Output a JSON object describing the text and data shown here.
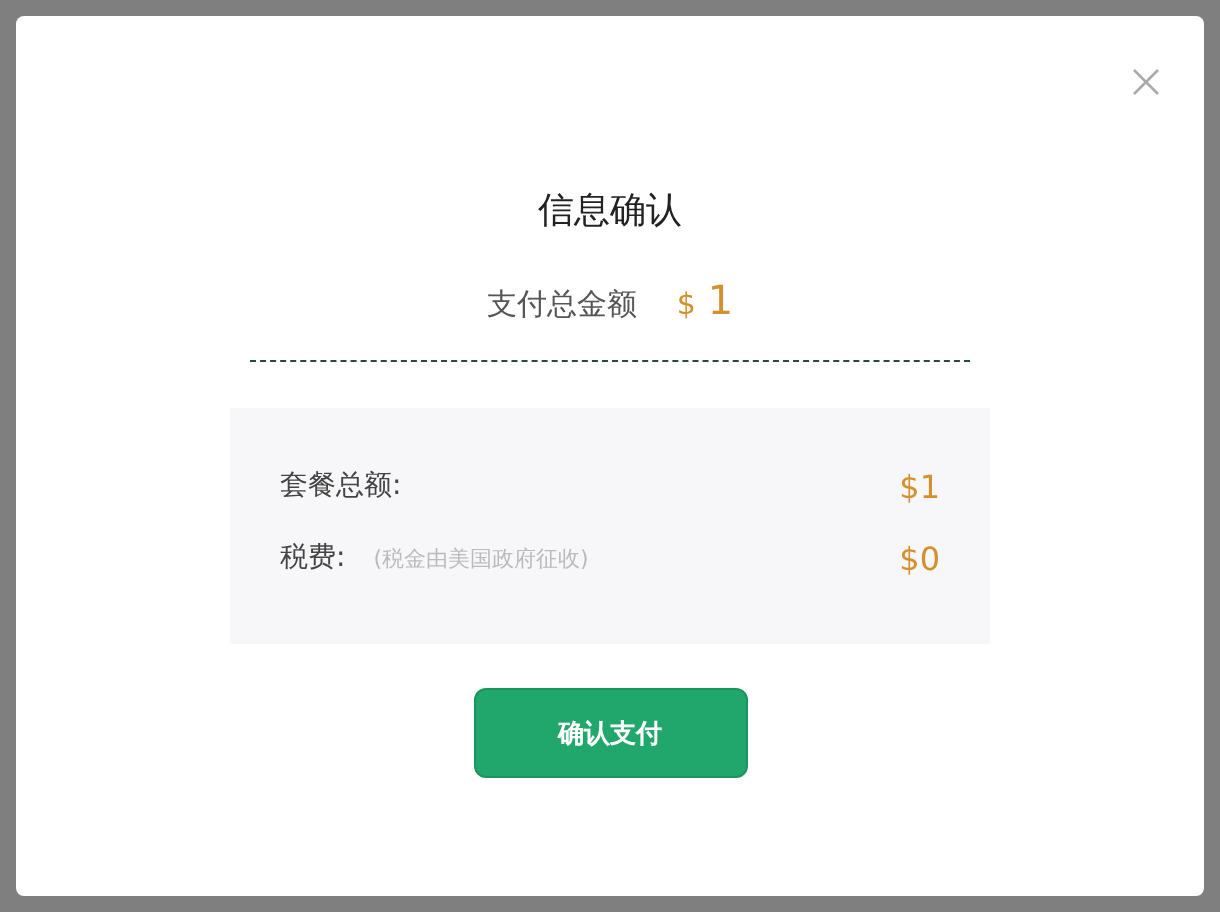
{
  "dialog": {
    "title": "信息确认",
    "total_label": "支付总金额",
    "total_currency": "$",
    "total_amount": "1",
    "items": [
      {
        "label": "套餐总额:",
        "amount": "$1"
      },
      {
        "label": "税费:",
        "note": "(税金由美国政府征收)",
        "amount": "$0"
      }
    ],
    "confirm_button": "确认支付"
  }
}
